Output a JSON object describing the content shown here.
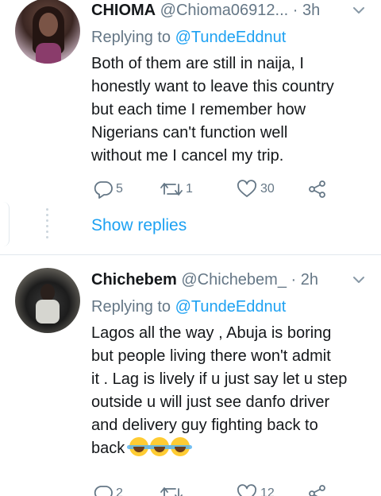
{
  "tweets": [
    {
      "name": "CHIOMA",
      "handle": "@Chioma06912...",
      "dot": "·",
      "time": "3h",
      "replying_prefix": "Replying to ",
      "replying_to": "@TundeEddnut",
      "text_lines": [
        "Both of them are still in naija, I",
        "honestly want to leave this country",
        "but each time I remember how",
        "Nigerians can't function well",
        "without me I cancel my trip."
      ],
      "replies": "5",
      "retweets": "1",
      "likes": "30",
      "show_replies": "Show replies"
    },
    {
      "name": "Chichebem",
      "handle": "@Chichebem_",
      "dot": "·",
      "time": "2h",
      "replying_prefix": "Replying to ",
      "replying_to": "@TundeEddnut",
      "text_lines": [
        "Lagos all the way , Abuja is boring",
        "but people living there won't admit",
        "it . Lag is lively if u just say let u step",
        "outside u will just see danfo driver",
        "and delivery guy fighting back to",
        "back"
      ],
      "emoji": "face-with-tears-of-joy x3",
      "replies": "2",
      "retweets": "",
      "likes": "12"
    }
  ],
  "icons": {
    "reply": "reply-icon",
    "retweet": "retweet-icon",
    "like": "heart-icon",
    "share": "share-icon",
    "menu": "chevron-down-icon"
  },
  "colors": {
    "accent": "#1da1f2",
    "muted": "#657786",
    "text": "#14171a",
    "divider": "#e1e8ed"
  }
}
